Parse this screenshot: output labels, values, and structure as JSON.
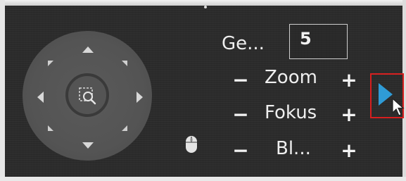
{
  "ptz": {
    "speed_label": "Ge...",
    "speed_value": "5",
    "zoom_label": "Zoom",
    "focus_label": "Fokus",
    "iris_label": "Bl...",
    "minus_symbol": "−",
    "plus_symbol": "+"
  },
  "icons": {
    "joystick": "ptz-joystick",
    "zoom_area": "zoom-area-icon",
    "mouse": "mouse-icon",
    "play": "play-icon",
    "cursor": "cursor-icon"
  },
  "colors": {
    "play_accent": "#2f9bd6",
    "highlight_frame": "#d71f1f",
    "text": "#efefef"
  }
}
